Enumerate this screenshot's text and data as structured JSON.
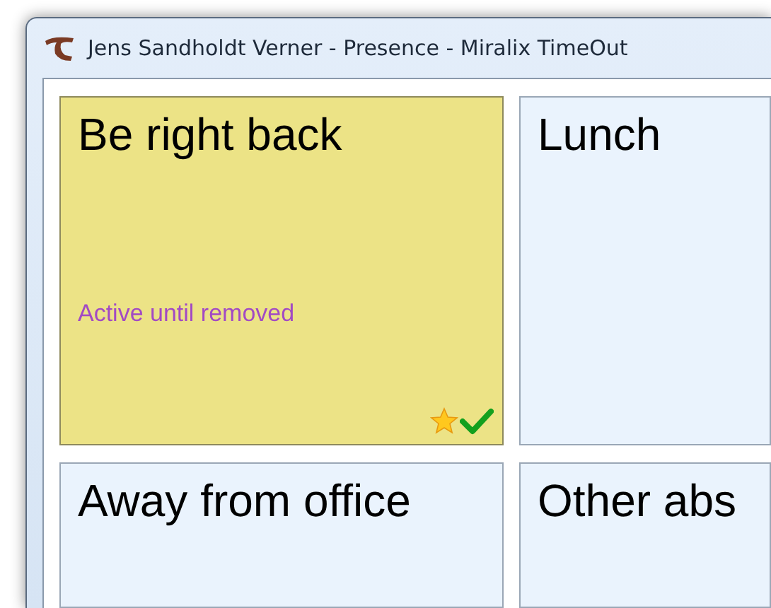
{
  "window": {
    "title": "Jens Sandholdt Verner - Presence - Miralix TimeOut"
  },
  "tiles": [
    {
      "label": "Be right back",
      "selected": true,
      "note": "Active until removed"
    },
    {
      "label": "Lunch",
      "selected": false
    },
    {
      "label": "Away from office",
      "selected": false
    },
    {
      "label": "Other abs",
      "selected": false
    }
  ]
}
